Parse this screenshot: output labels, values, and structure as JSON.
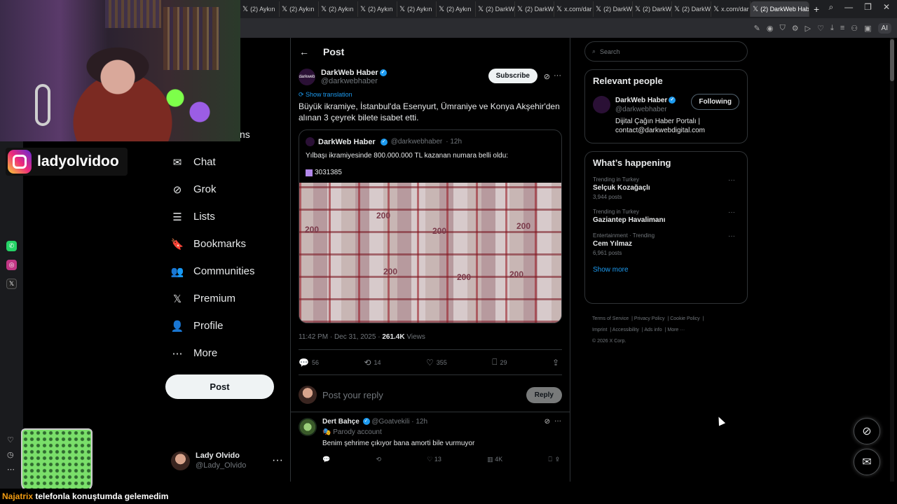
{
  "browser": {
    "tabs": [
      {
        "label": "(2) Aykın",
        "icon": "x-icon"
      },
      {
        "label": "(2) Aykın",
        "icon": "x-icon"
      },
      {
        "label": "(2) Aykın",
        "icon": "x-icon"
      },
      {
        "label": "(2) Aykın",
        "icon": "x-icon"
      },
      {
        "label": "(2) Aykın",
        "icon": "x-icon"
      },
      {
        "label": "(2) Aykın",
        "icon": "x-icon"
      },
      {
        "label": "(2) DarkW",
        "icon": "x-icon"
      },
      {
        "label": "(2) DarkW",
        "icon": "x-icon"
      },
      {
        "label": "x.com/dar",
        "icon": "x-icon"
      },
      {
        "label": "(2) DarkW",
        "icon": "x-icon"
      },
      {
        "label": "(2) DarkW",
        "icon": "x-icon"
      },
      {
        "label": "(2) DarkW",
        "icon": "x-icon"
      },
      {
        "label": "x.com/dar",
        "icon": "x-icon"
      }
    ],
    "active_tab": "(2) DarkWeb Hab",
    "ai_label": "AI"
  },
  "stream": {
    "instagram_handle": "ladyolvidoo",
    "ticker_user": "Najatrix",
    "ticker_text": "telefonla konuştumda gelemedim"
  },
  "nav": {
    "cut_text": "ns",
    "items": [
      {
        "label": "Chat",
        "icon": "envelope-icon",
        "glyph": "✉"
      },
      {
        "label": "Grok",
        "icon": "grok-icon",
        "glyph": "⊘"
      },
      {
        "label": "Lists",
        "icon": "list-icon",
        "glyph": "☰"
      },
      {
        "label": "Bookmarks",
        "icon": "bookmark-icon",
        "glyph": "🔖"
      },
      {
        "label": "Communities",
        "icon": "people-icon",
        "glyph": "👥"
      },
      {
        "label": "Premium",
        "icon": "x-logo-icon",
        "glyph": "𝕏"
      },
      {
        "label": "Profile",
        "icon": "person-icon",
        "glyph": "👤"
      },
      {
        "label": "More",
        "icon": "more-circle-icon",
        "glyph": "⋯"
      }
    ],
    "post_label": "Post",
    "account": {
      "name": "Lady Olvido",
      "handle": "@Lady_Olvido"
    }
  },
  "post": {
    "header_title": "Post",
    "author": {
      "name": "DarkWeb Haber",
      "handle": "@darkwebhaber",
      "logo_text": "darkweb"
    },
    "subscribe_label": "Subscribe",
    "show_translation": "Show translation",
    "text": "Büyük ikramiye, İstanbul'da Esenyurt, Ümraniye ve Konya Akşehir'den alınan 3 çeyrek bilete isabet etti.",
    "quote": {
      "name": "DarkWeb Haber",
      "handle": "@darkwebhaber",
      "age": "· 12h",
      "text": "Yılbaşı ikramiyesinde 800.000.000 TL kazanan numara belli oldu:",
      "number": "3031385",
      "banknote_value": "200"
    },
    "timestamp": "11:42 PM · Dec 31, 2025 · ",
    "views_count": "261.4K",
    "views_label": " Views",
    "stats": {
      "replies": "56",
      "reposts": "14",
      "likes": "355",
      "bookmarks": "29"
    },
    "reply_placeholder": "Post your reply",
    "reply_label": "Reply"
  },
  "comment": {
    "name": "Dert Bahçe",
    "handle": "@Goatvekili",
    "age": "· 12h",
    "badge": "Parody account",
    "text": "Benim şehrime çıkıyor bana amorti bile vurmuyor",
    "stats": {
      "likes": "13",
      "views": "4K"
    }
  },
  "sidebar": {
    "search_placeholder": "Search",
    "relevant_title": "Relevant people",
    "person": {
      "name": "DarkWeb Haber",
      "handle": "@darkwebhaber",
      "bio_line1": "Dijital Çağın Haber Portalı |",
      "bio_line2": "contact@darkwebdigital.com",
      "follow_label": "Following"
    },
    "happening_title": "What’s happening",
    "trends": [
      {
        "context": "Trending in Turkey",
        "name": "Selçuk Kozağaçlı",
        "count": "3,944 posts"
      },
      {
        "context": "Trending in Turkey",
        "name": "Gaziantep Havalimanı",
        "count": ""
      },
      {
        "context": "Entertainment · Trending",
        "name": "Cem Yılmaz",
        "count": "6,961 posts"
      }
    ],
    "show_more": "Show more",
    "footer": {
      "terms": "Terms of Service",
      "privacy": "Privacy Policy",
      "cookie": "Cookie Policy",
      "imprint": "Imprint",
      "accessibility": "Accessibility",
      "ads": "Ads info",
      "more": "More ···",
      "copyright": "© 2026 X Corp."
    }
  },
  "colors": {
    "accent": "#1d9bf0",
    "background": "#000000",
    "border": "#2f3336",
    "muted": "#71767b"
  }
}
